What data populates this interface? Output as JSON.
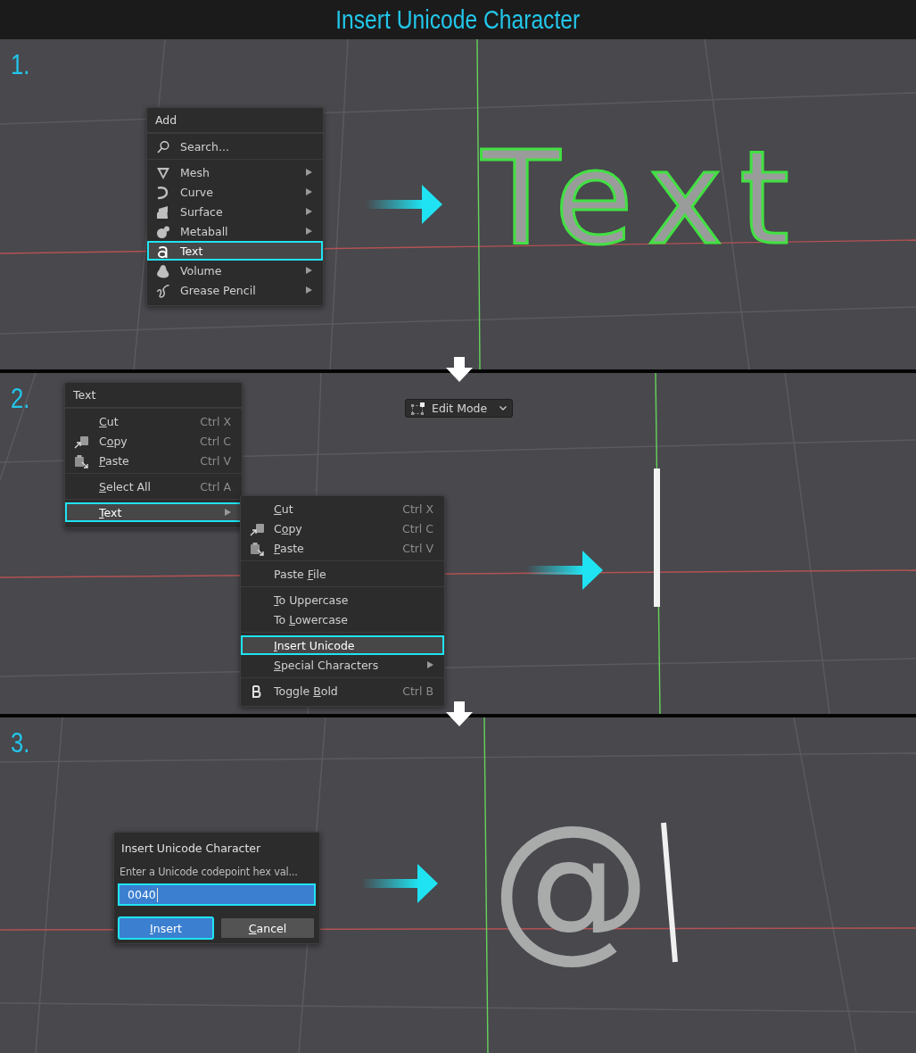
{
  "title": "Insert Unicode Character",
  "steps": [
    {
      "number": "1.",
      "add_menu": {
        "title": "Add",
        "groups": [
          [
            {
              "label": {
                "after": "Search..."
              },
              "has_submenu": false,
              "selected": false
            }
          ],
          [
            {
              "label": {
                "after": "Mesh"
              },
              "has_submenu": true,
              "selected": false
            },
            {
              "label": {
                "after": "Curve"
              },
              "has_submenu": true,
              "selected": false
            },
            {
              "label": {
                "after": "Surface"
              },
              "has_submenu": true,
              "selected": false
            },
            {
              "label": {
                "after": "Metaball"
              },
              "has_submenu": true,
              "selected": false
            },
            {
              "label": {
                "after": "Text"
              },
              "has_submenu": false,
              "selected": true
            },
            {
              "label": {
                "after": "Volume"
              },
              "has_submenu": true,
              "selected": false
            },
            {
              "label": {
                "after": "Grease Pencil"
              },
              "has_submenu": true,
              "selected": false
            }
          ]
        ]
      },
      "result_text": "Text"
    },
    {
      "number": "2.",
      "mode_dropdown": {
        "label": "Edit Mode"
      },
      "text_menu": {
        "title": "Text",
        "groups": [
          [
            {
              "label": {
                "key": "C",
                "after": "ut"
              },
              "shortcut": "Ctrl X",
              "has_submenu": false,
              "selected": false
            },
            {
              "label": {
                "before": "C",
                "key": "o",
                "after": "py"
              },
              "shortcut": "Ctrl C",
              "has_submenu": false,
              "selected": false
            },
            {
              "label": {
                "key": "P",
                "after": "aste"
              },
              "shortcut": "Ctrl V",
              "has_submenu": false,
              "selected": false
            }
          ],
          [
            {
              "label": {
                "key": "S",
                "after": "elect All"
              },
              "shortcut": "Ctrl A",
              "has_submenu": false,
              "selected": false
            }
          ],
          [
            {
              "label": {
                "key": "T",
                "after": "ext"
              },
              "has_submenu": true,
              "selected": true
            }
          ]
        ]
      },
      "submenu": {
        "groups": [
          [
            {
              "label": {
                "key": "C",
                "after": "ut"
              },
              "shortcut": "Ctrl X",
              "has_submenu": false,
              "selected": false
            },
            {
              "label": {
                "before": "C",
                "key": "o",
                "after": "py"
              },
              "shortcut": "Ctrl C",
              "has_submenu": false,
              "selected": false
            },
            {
              "label": {
                "key": "P",
                "after": "aste"
              },
              "shortcut": "Ctrl V",
              "has_submenu": false,
              "selected": false
            }
          ],
          [
            {
              "label": {
                "before": "Paste ",
                "key": "F",
                "after": "ile"
              },
              "has_submenu": false,
              "selected": false
            }
          ],
          [
            {
              "label": {
                "key": "T",
                "after": "o Uppercase"
              },
              "has_submenu": false,
              "selected": false
            },
            {
              "label": {
                "before": "To ",
                "key": "L",
                "after": "owercase"
              },
              "has_submenu": false,
              "selected": false
            }
          ],
          [
            {
              "label": {
                "key": "I",
                "after": "nsert Unicode"
              },
              "has_submenu": false,
              "selected": true
            },
            {
              "label": {
                "key": "S",
                "after": "pecial Characters"
              },
              "has_submenu": true,
              "selected": false
            }
          ],
          [
            {
              "label": {
                "before": "Toggle ",
                "key": "B",
                "after": "old"
              },
              "shortcut": "Ctrl B",
              "has_submenu": false,
              "selected": false
            }
          ]
        ]
      }
    },
    {
      "number": "3.",
      "dialog": {
        "title": "Insert Unicode Character",
        "description": "Enter a Unicode codepoint hex val...",
        "field": {
          "value": "0040",
          "highlighted": true
        },
        "buttons": [
          {
            "label": {
              "key": "I",
              "after": "nsert"
            },
            "selected": true
          },
          {
            "label": {
              "key": "C",
              "after": "ancel"
            },
            "selected": false
          }
        ]
      },
      "result_text": "@"
    }
  ]
}
